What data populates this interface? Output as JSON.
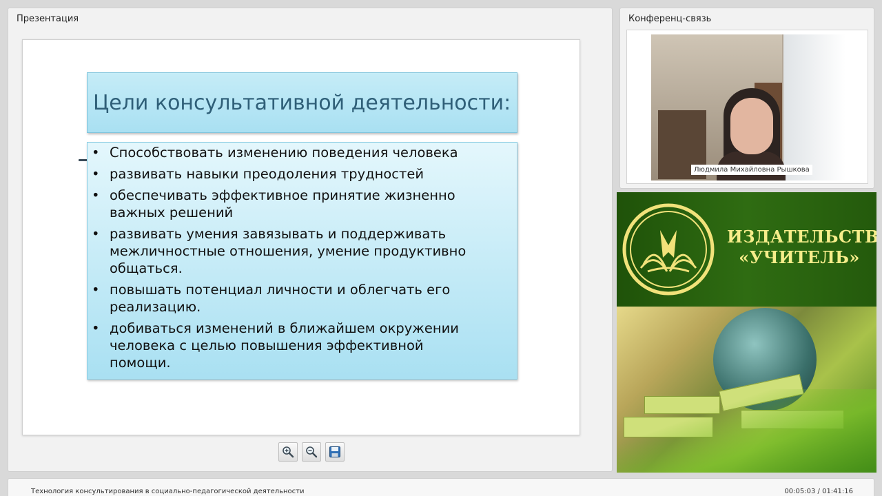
{
  "presentation": {
    "panel_title": "Презентация",
    "slide": {
      "title": "Цели консультативной деятельности:",
      "bullet_symbol": "•",
      "bullets": [
        {
          "lines": [
            "Способствовать изменению поведения человека"
          ]
        },
        {
          "lines": [
            "развивать навыки преодоления трудностей"
          ]
        },
        {
          "lines": [
            "обеспечивать эффективное принятие жизненно",
            "важных решений"
          ]
        },
        {
          "lines": [
            "развивать умения завязывать и поддерживать",
            "межличностные отношения, умение продуктивно",
            "общаться."
          ]
        },
        {
          "lines": [
            "повышать потенциал личности и облегчать его",
            "реализацию."
          ]
        },
        {
          "lines": [
            "добиваться изменений в ближайшем окружении",
            "человека с целью повышения эффективной",
            "помощи."
          ]
        }
      ]
    },
    "toolbar": {
      "zoom_in_icon": "zoom-in-icon",
      "zoom_out_icon": "zoom-out-icon",
      "save_icon": "floppy-disk-icon"
    }
  },
  "conference": {
    "panel_title": "Конференц-связь",
    "speaker_name": "Людмила Михайловна Рышкова"
  },
  "publisher": {
    "name_line1": "ИЗДАТЕЛЬСТВО",
    "name_line2": "«УЧИТЕЛЬ»",
    "brand_color": "#2a6410",
    "text_color": "#f6ed8a"
  },
  "footer": {
    "course_title": "Технология консультирования в социально-педагогической деятельности",
    "time": "00:05:03 / 01:41:16"
  }
}
